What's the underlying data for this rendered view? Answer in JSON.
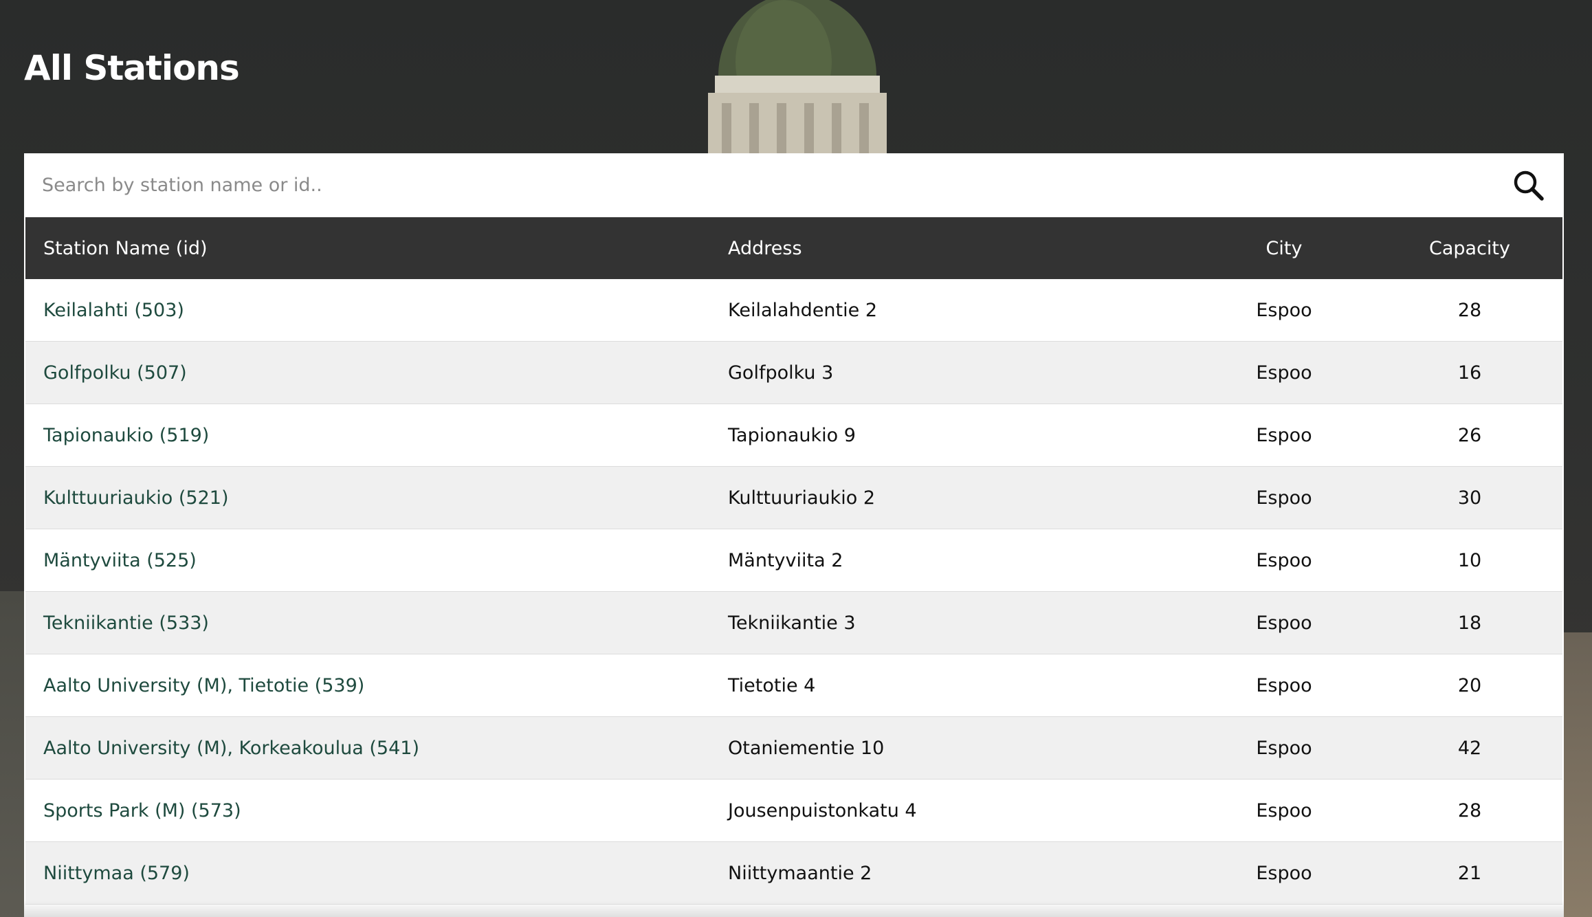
{
  "page": {
    "title": "All Stations"
  },
  "search": {
    "placeholder": "Search by station name or id..",
    "value": "",
    "button_icon": "search-icon"
  },
  "table": {
    "columns": [
      "Station Name (id)",
      "Address",
      "City",
      "Capacity"
    ],
    "rows": [
      {
        "name": "Keilalahti (503)",
        "address": "Keilalahdentie 2",
        "city": "Espoo",
        "capacity": "28"
      },
      {
        "name": "Golfpolku (507)",
        "address": "Golfpolku 3",
        "city": "Espoo",
        "capacity": "16"
      },
      {
        "name": "Tapionaukio (519)",
        "address": "Tapionaukio 9",
        "city": "Espoo",
        "capacity": "26"
      },
      {
        "name": "Kulttuuriaukio (521)",
        "address": "Kulttuuriaukio 2",
        "city": "Espoo",
        "capacity": "30"
      },
      {
        "name": "Mäntyviita (525)",
        "address": "Mäntyviita 2",
        "city": "Espoo",
        "capacity": "10"
      },
      {
        "name": "Tekniikantie (533)",
        "address": "Tekniikantie 3",
        "city": "Espoo",
        "capacity": "18"
      },
      {
        "name": "Aalto University (M), Tietotie (539)",
        "address": "Tietotie 4",
        "city": "Espoo",
        "capacity": "20"
      },
      {
        "name": "Aalto University (M), Korkeakoulua (541)",
        "address": "Otaniementie 10",
        "city": "Espoo",
        "capacity": "42"
      },
      {
        "name": "Sports Park (M) (573)",
        "address": "Jousenpuistonkatu 4",
        "city": "Espoo",
        "capacity": "28"
      },
      {
        "name": "Niittymaa (579)",
        "address": "Niittymaantie 2",
        "city": "Espoo",
        "capacity": "21"
      }
    ]
  },
  "colors": {
    "header_bg": "#333333",
    "link": "#1e4a3e",
    "row_alt": "#f0f0f0"
  }
}
